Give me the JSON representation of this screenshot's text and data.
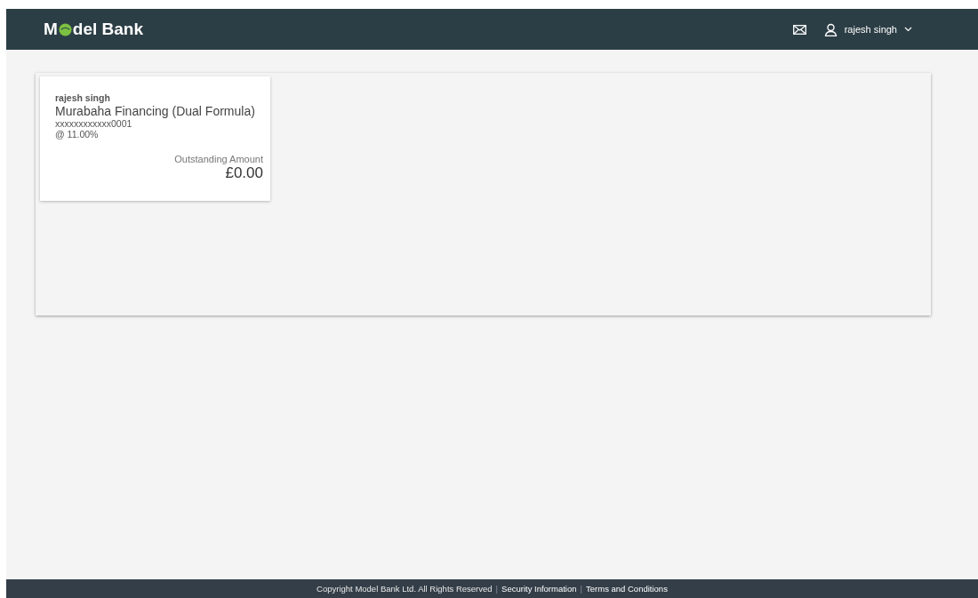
{
  "header": {
    "logo_left": "M",
    "logo_right": "del Bank",
    "user": "rajesh singh"
  },
  "cards": [
    {
      "holder": "rajesh singh",
      "product": "Murabaha Financing (Dual Formula)",
      "account": "xxxxxxxxxxxx0001",
      "rate": "@ 11.00%",
      "amount_label": "Outstanding Amount",
      "amount": "£0.00"
    }
  ],
  "footer": {
    "separator": "|",
    "items": [
      {
        "text": "Copyright Model Bank Ltd. All Rights Reserved",
        "kind": "text"
      },
      {
        "text": "Security Information",
        "kind": "link"
      },
      {
        "text": "Terms and Conditions",
        "kind": "link"
      }
    ]
  }
}
